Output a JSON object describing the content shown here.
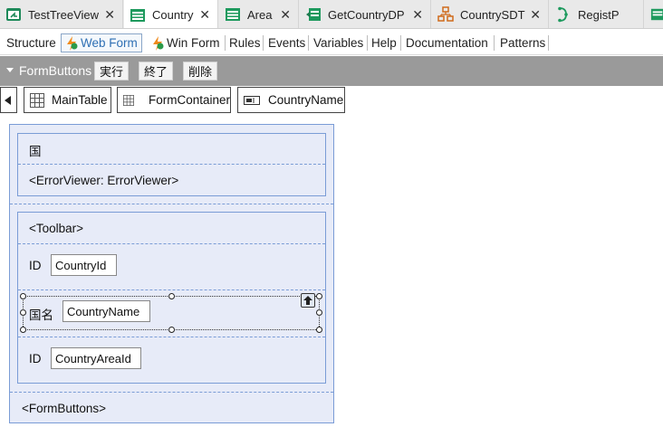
{
  "doc_tabs": [
    {
      "label": "TestTreeView",
      "icon": "tree-view-icon"
    },
    {
      "label": "Country",
      "icon": "transaction-icon",
      "active": true
    },
    {
      "label": "Area",
      "icon": "transaction-icon"
    },
    {
      "label": "GetCountryDP",
      "icon": "data-provider-icon"
    },
    {
      "label": "CountrySDT",
      "icon": "sdt-icon"
    },
    {
      "label": "RegistP",
      "icon": "procedure-icon"
    }
  ],
  "sub_tabs": {
    "structure": "Structure",
    "web_form": "Web Form",
    "win_form": "Win Form",
    "rules": "Rules",
    "events": "Events",
    "variables": "Variables",
    "help": "Help",
    "documentation": "Documentation",
    "patterns": "Patterns"
  },
  "grey_bar": {
    "title": "FormButtons",
    "buttons": [
      "実行",
      "終了",
      "削除"
    ]
  },
  "breadcrumb": [
    "MainTable",
    "FormContainer",
    "CountryName"
  ],
  "form": {
    "title": "国",
    "error_viewer": "<ErrorViewer: ErrorViewer>",
    "toolbar": "<Toolbar>",
    "rows": [
      {
        "label": "ID",
        "field": "CountryId"
      },
      {
        "label": "国名",
        "field": "CountryName"
      },
      {
        "label": "ID",
        "field": "CountryAreaId"
      }
    ],
    "form_buttons": "<FormButtons>"
  },
  "colors": {
    "canvas_bg": "#e7ebf8",
    "canvas_border": "#7a9cd6",
    "grey_bar": "#9a9a9a",
    "active_tab_text": "#2e6fb4"
  }
}
